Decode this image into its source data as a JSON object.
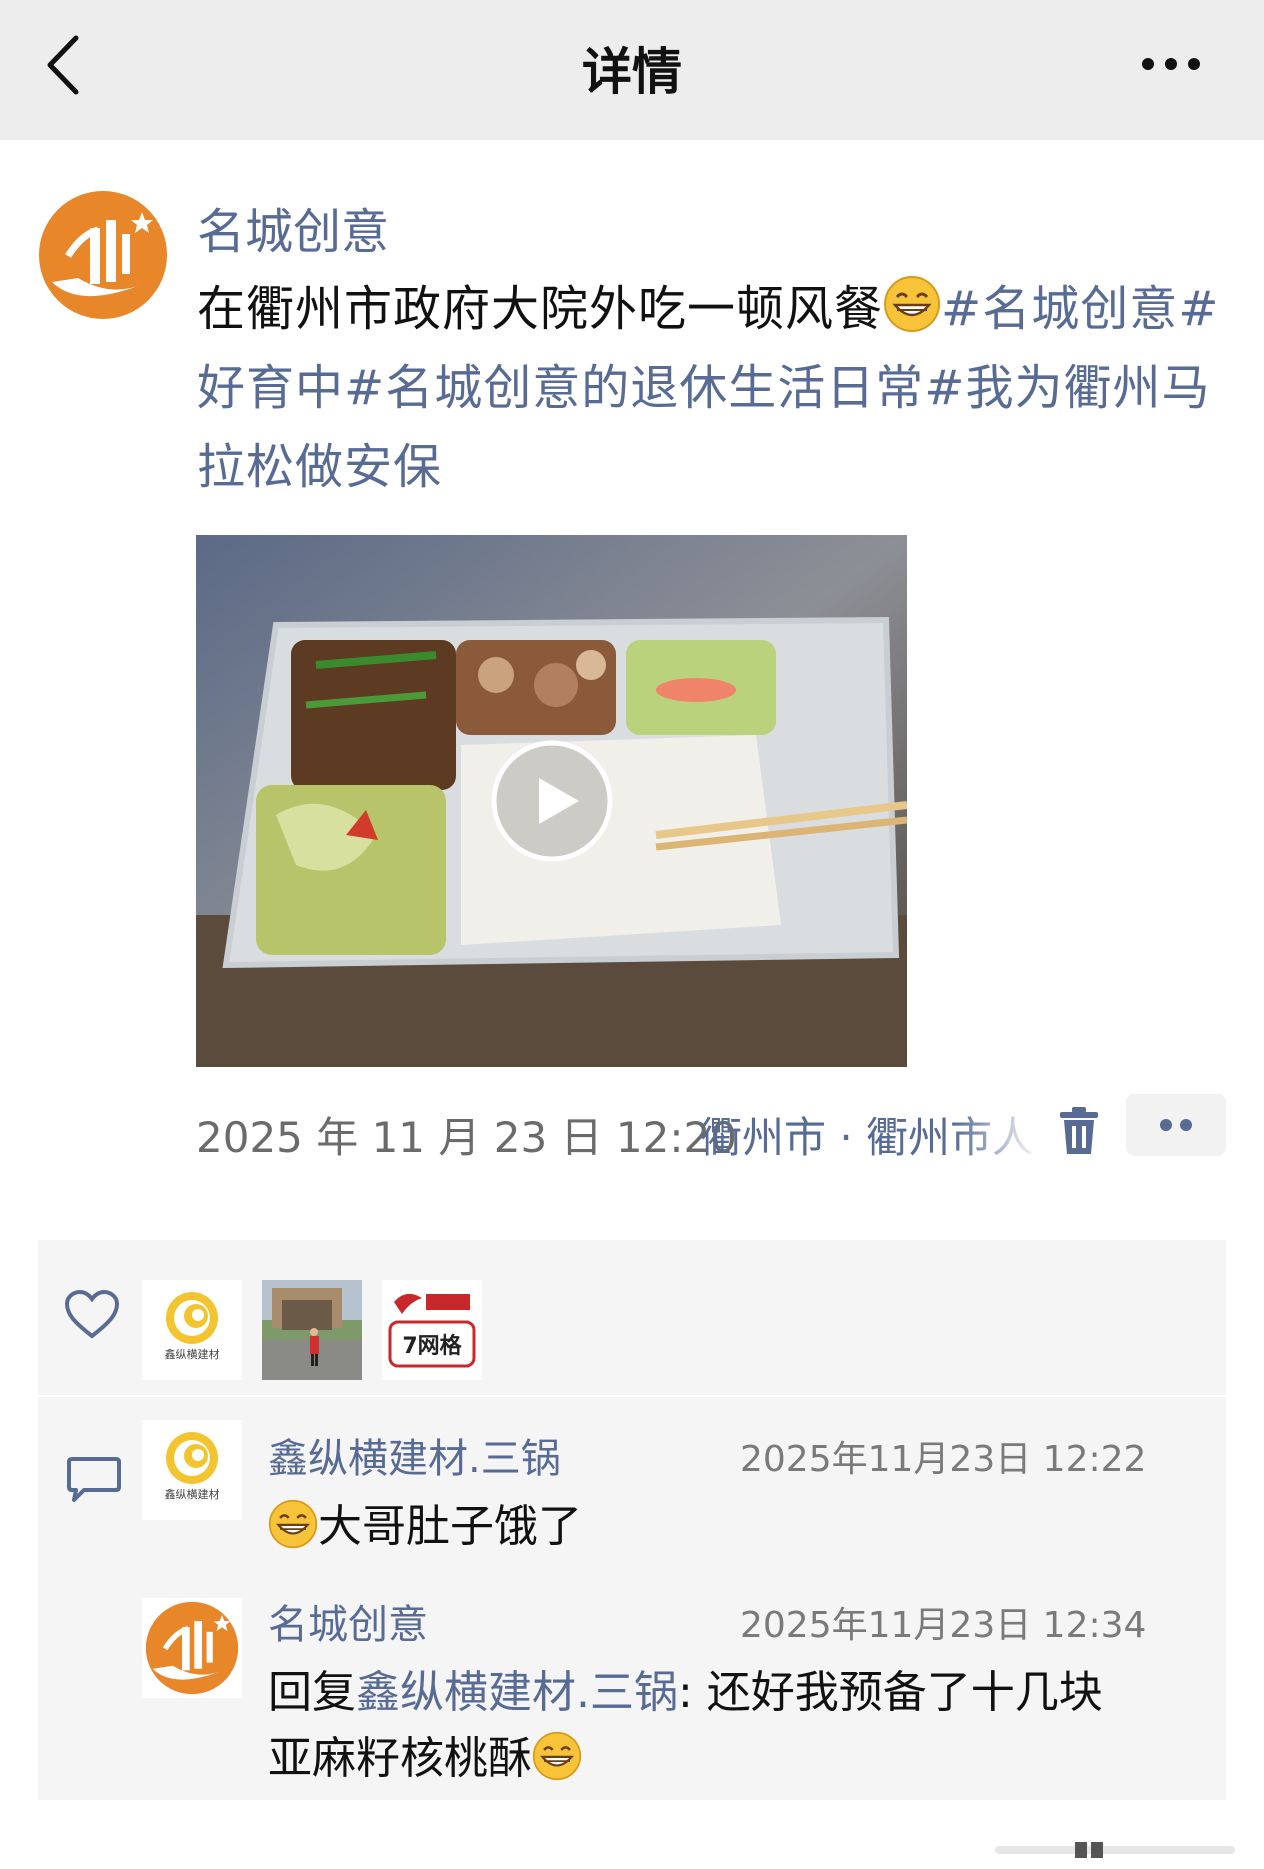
{
  "nav": {
    "title": "详情",
    "back_icon": "chevron-left-icon",
    "more_icon": "more-dots-icon"
  },
  "post": {
    "author": "名城创意",
    "text_plain": "在衢州市政府大院外吃一顿风餐",
    "text_tags": "#名城创意#好育中#名城创意的退休生活日常#我为衢州马拉松做安保",
    "emoji": "grinning-face-icon",
    "video": {
      "description_icon": "play-button-icon"
    },
    "time": "2025 年 11 月 23 日 12:20",
    "location": "衢州市 · 衢州市人",
    "delete_icon": "trash-icon",
    "more_icon": "two-dots-icon"
  },
  "likes": {
    "icon": "heart-icon",
    "users": [
      {
        "name": "鑫纵横建材",
        "avatar": "swirl-logo"
      },
      {
        "name": "photo-avatar",
        "avatar": "photo"
      },
      {
        "name": "7网格",
        "avatar": "logo-7网格"
      }
    ],
    "badge_text": "7网格",
    "logo_small_text": "鑫纵横建材"
  },
  "comments": {
    "icon": "comment-bubble-icon",
    "items": [
      {
        "name": "鑫纵横建材.三锅",
        "time": "2025年11月23日 12:22",
        "text": "大哥肚子饿了"
      },
      {
        "name": "名城创意",
        "time": "2025年11月23日 12:34",
        "reply_prefix": "回复",
        "reply_to": "鑫纵横建材.三锅",
        "text_line1": ": 还好我预备了十几块",
        "text_line2": "亚麻籽核桃酥"
      }
    ]
  },
  "colors": {
    "link": "#576b95",
    "navbar_bg": "#ededed",
    "panel_bg": "#f5f5f5",
    "logo_orange": "#e8862a"
  }
}
